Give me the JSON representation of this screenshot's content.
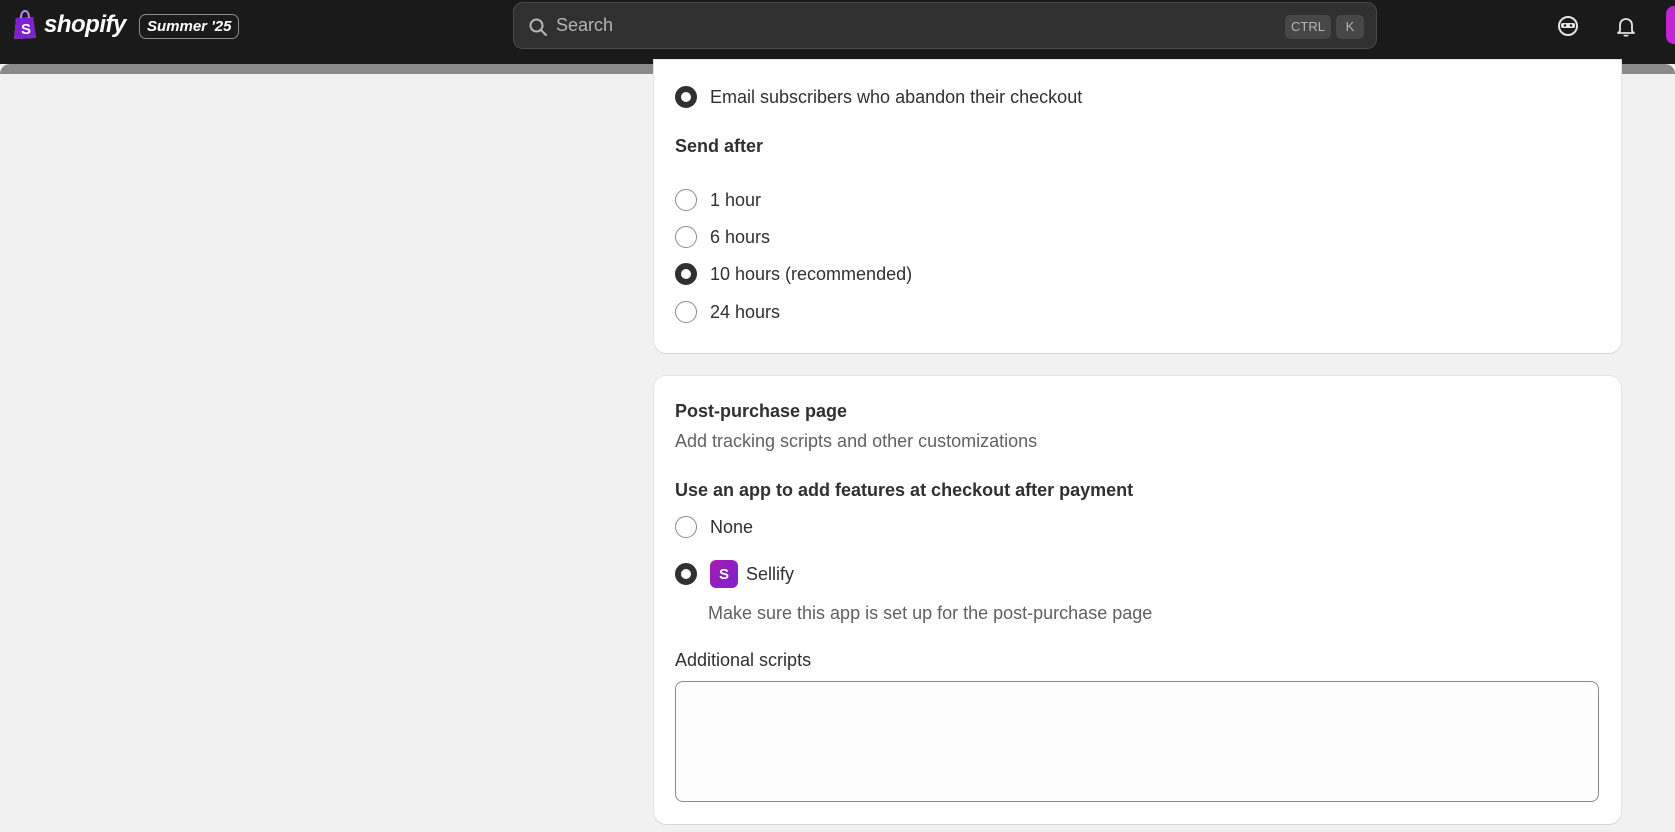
{
  "topbar": {
    "brand": "shopify",
    "edition_badge": "Summer '25",
    "search": {
      "placeholder": "Search",
      "shortcut_modifier": "CTRL",
      "shortcut_key": "K"
    },
    "icons": [
      "account-switch-icon",
      "notifications-icon"
    ]
  },
  "abandoned_checkout_card": {
    "option_label": "Email subscribers who abandon their checkout",
    "send_after_heading": "Send after",
    "send_after_options": [
      {
        "label": "1 hour",
        "selected": false
      },
      {
        "label": "6 hours",
        "selected": false
      },
      {
        "label": "10 hours (recommended)",
        "selected": true
      },
      {
        "label": "24 hours",
        "selected": false
      }
    ]
  },
  "post_purchase_card": {
    "title": "Post-purchase page",
    "subtitle": "Add tracking scripts and other customizations",
    "app_heading": "Use an app to add features at checkout after payment",
    "options": [
      {
        "label": "None",
        "selected": false
      },
      {
        "label": "Sellify",
        "selected": true,
        "help": "Make sure this app is set up for the post-purchase page"
      }
    ],
    "additional_scripts_label": "Additional scripts",
    "additional_scripts_value": ""
  },
  "colors": {
    "topbar": "#1a1a1a",
    "page_bg": "#f1f1f1",
    "app_icon": "#a21caf",
    "radio_checked": "#303030"
  }
}
